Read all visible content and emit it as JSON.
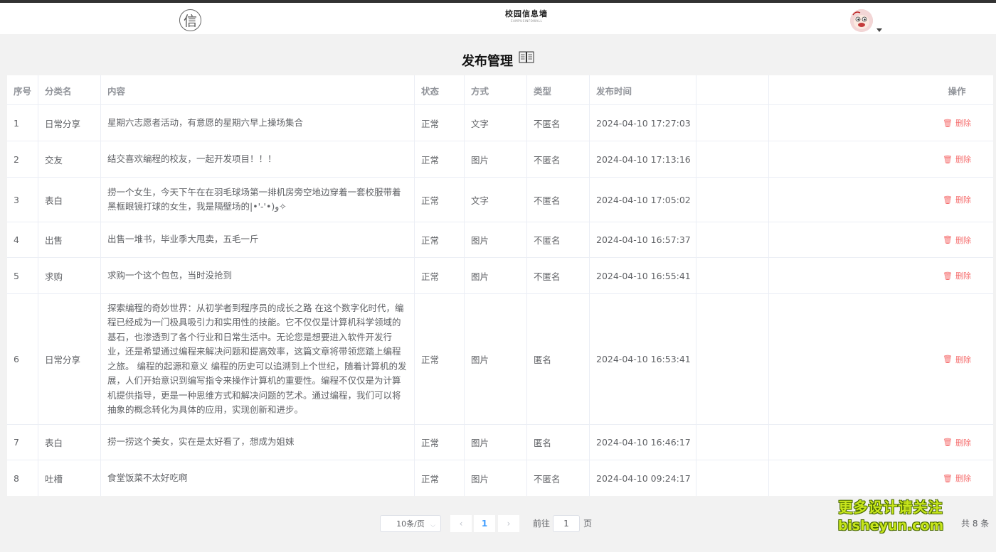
{
  "header": {
    "logo_glyph": "信",
    "brand_title": "校园信息墙",
    "brand_subtitle": "CAMPUSINFOWALL",
    "avatar_icon": "user-avatar"
  },
  "page": {
    "title": "发布管理",
    "title_icon": "book-icon"
  },
  "table": {
    "columns": {
      "index": "序号",
      "category": "分类名",
      "content": "内容",
      "status": "状态",
      "method": "方式",
      "type": "类型",
      "time": "发布时间",
      "actions": "操作"
    },
    "delete_label": "删除",
    "rows": [
      {
        "index": "1",
        "category": "日常分享",
        "content": "星期六志愿者活动，有意愿的星期六早上操场集合",
        "status": "正常",
        "method": "文字",
        "type": "不匿名",
        "time": "2024-04-10 17:27:03"
      },
      {
        "index": "2",
        "category": "交友",
        "content": "结交喜欢编程的校友，一起开发项目！！！",
        "status": "正常",
        "method": "图片",
        "type": "不匿名",
        "time": "2024-04-10 17:13:16"
      },
      {
        "index": "3",
        "category": "表白",
        "content": "捞一个女生，今天下午在在羽毛球场第一排机房旁空地边穿着一套校服带着黑框眼镜打球的女生，我是隔壁场的|•'-'•)و✧",
        "status": "正常",
        "method": "文字",
        "type": "不匿名",
        "time": "2024-04-10 17:05:02"
      },
      {
        "index": "4",
        "category": "出售",
        "content": "出售一堆书，毕业季大甩卖，五毛一斤",
        "status": "正常",
        "method": "图片",
        "type": "不匿名",
        "time": "2024-04-10 16:57:37"
      },
      {
        "index": "5",
        "category": "求购",
        "content": "求购一个这个包包，当时没抢到",
        "status": "正常",
        "method": "图片",
        "type": "不匿名",
        "time": "2024-04-10 16:55:41"
      },
      {
        "index": "6",
        "category": "日常分享",
        "content": "探索编程的奇妙世界：从初学者到程序员的成长之路 在这个数字化时代，编程已经成为一门极具吸引力和实用性的技能。它不仅仅是计算机科学领域的基石，也渗透到了各个行业和日常生活中。无论您是想要进入软件开发行业，还是希望通过编程来解决问题和提高效率，这篇文章将带领您踏上编程之旅。 编程的起源和意义 编程的历史可以追溯到上个世纪，随着计算机的发展，人们开始意识到编写指令来操作计算机的重要性。编程不仅仅是为计算机提供指导，更是一种思维方式和解决问题的艺术。通过编程，我们可以将抽象的概念转化为具体的应用，实现创新和进步。",
        "status": "正常",
        "method": "图片",
        "type": "匿名",
        "time": "2024-04-10 16:53:41"
      },
      {
        "index": "7",
        "category": "表白",
        "content": "捞一捞这个美女，实在是太好看了，想成为姐妹",
        "status": "正常",
        "method": "图片",
        "type": "匿名",
        "time": "2024-04-10 16:46:17"
      },
      {
        "index": "8",
        "category": "吐槽",
        "content": "食堂饭菜不太好吃啊",
        "status": "正常",
        "method": "图片",
        "type": "不匿名",
        "time": "2024-04-10 09:24:17"
      }
    ]
  },
  "pagination": {
    "page_size": "10条/页",
    "current_page": "1",
    "goto_label": "前往",
    "goto_value": "1",
    "page_unit": "页",
    "total": "共 8 条"
  },
  "watermark": {
    "line1": "更多设计请关注",
    "line2": "bisheyun.com"
  },
  "colors": {
    "accent": "#409eff",
    "danger": "#f56c6c",
    "watermark": "#c8e61c"
  }
}
